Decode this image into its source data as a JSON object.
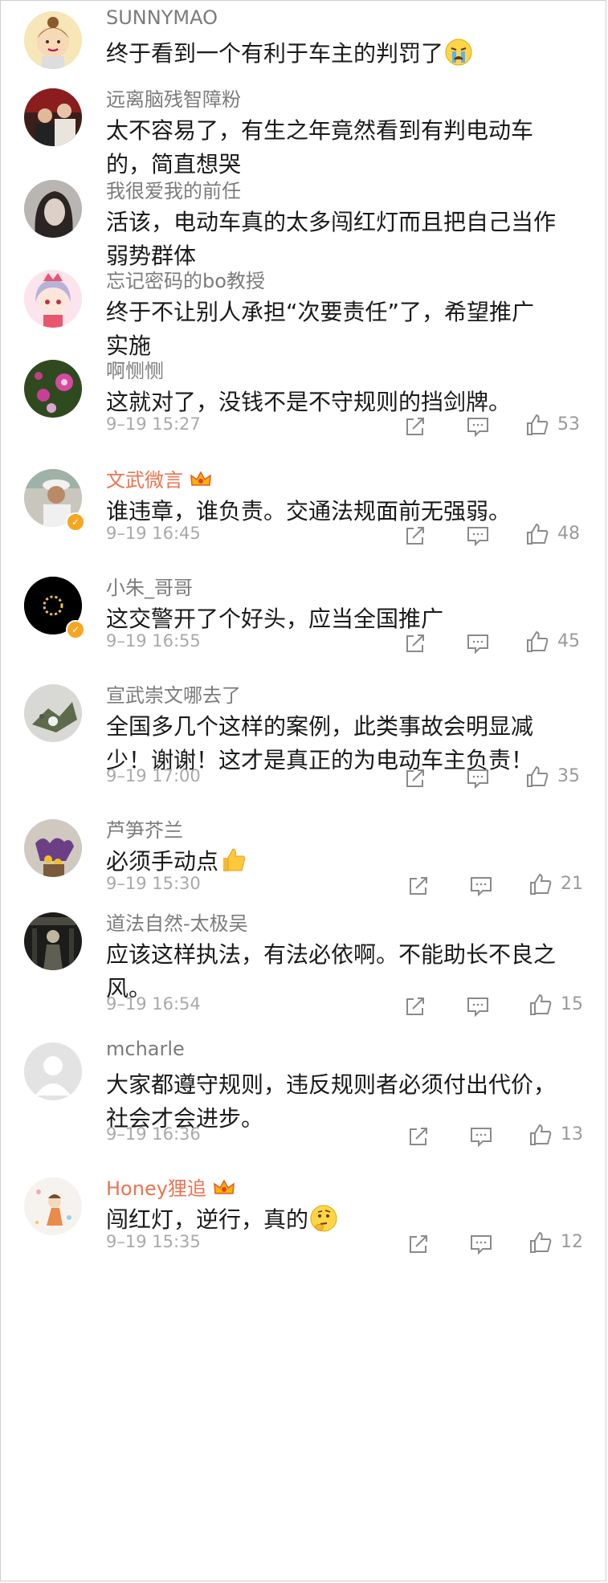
{
  "comments": [
    {
      "name": "SUNNYMAO",
      "text": "终于看到一个有利于车主的判罚了",
      "emoji": "crying-face-icon"
    },
    {
      "name": "远离脑残智障粉",
      "text": "太不容易了，有生之年竟然看到有判电动车的，简直想哭"
    },
    {
      "name": "我很爱我的前任",
      "text": "活该，电动车真的太多闯红灯而且把自己当作弱势群体"
    },
    {
      "name": "忘记密码的bo教授",
      "text": "终于不让别人承担“次要责任”了，希望推广实施"
    },
    {
      "name": "啊恻恻",
      "text": "这就对了，没钱不是不守规则的挡剑牌。",
      "time": "9–19 15:27",
      "likes": "53"
    },
    {
      "name": "文武微言",
      "text": "谁违章，谁负责。交通法规面前无强弱。",
      "time": "9–19 16:45",
      "likes": "48",
      "vip": true
    },
    {
      "name": "小朱_哥哥",
      "text": "这交警开了个好头，应当全国推广",
      "time": "9–19 16:55",
      "likes": "45"
    },
    {
      "name": "宣武崇文哪去了",
      "text": "全国多几个这样的案例，此类事故会明显减少！谢谢！这才是真正的为电动车主负责！",
      "time": "9–19 17:00",
      "likes": "35"
    },
    {
      "name": "芦笋芥兰",
      "text": "必须手动点",
      "emoji": "thumbs-up-emoji-icon",
      "time": "9–19 15:30",
      "likes": "21"
    },
    {
      "name": "道法自然-太极吴",
      "text": "应该这样执法，有法必依啊。不能助长不良之风。",
      "time": "9–19 16:54",
      "likes": "15"
    },
    {
      "name": "mcharle",
      "text": "大家都遵守规则，违反规则者必须付出代价，社会才会进步。",
      "time": "9–19 16:36",
      "likes": "13"
    },
    {
      "name": "Honey狸追",
      "text": "闯红灯，逆行，真的",
      "emoji": "thinking-face-icon",
      "time": "9–19 15:35",
      "likes": "12",
      "vip": true
    }
  ],
  "colors": {
    "name": "#7b7b7b",
    "vip_name": "#eb7350",
    "meta": "#a9a9a9",
    "verified_badge": "#f6a623"
  }
}
